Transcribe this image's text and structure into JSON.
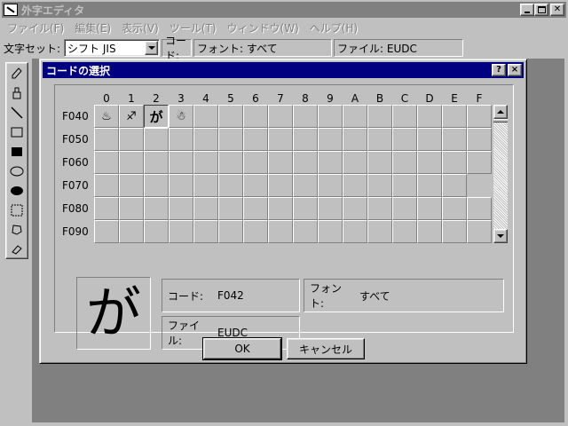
{
  "window": {
    "title": "外字エディタ"
  },
  "menu": [
    "ファイル(F)",
    "編集(E)",
    "表示(V)",
    "ツール(T)",
    "ウィンドウ(W)",
    "ヘルプ(H)"
  ],
  "toolbar": {
    "charset_label": "文字セット:",
    "charset_value": "シフト JIS",
    "code_label": "コード:",
    "font_status": "フォント: すべて",
    "file_status": "ファイル: EUDC"
  },
  "tools": [
    "pencil-icon",
    "brush-icon",
    "line-icon",
    "hollow-rect-icon",
    "filled-rect-icon",
    "hollow-ellipse-icon",
    "filled-ellipse-icon",
    "rect-select-icon",
    "freeform-select-icon",
    "eraser-icon"
  ],
  "dialog": {
    "title": "コードの選択",
    "help_btn": "?",
    "close_btn": "×",
    "columns": [
      "0",
      "1",
      "2",
      "3",
      "4",
      "5",
      "6",
      "7",
      "8",
      "9",
      "A",
      "B",
      "C",
      "D",
      "E",
      "F"
    ],
    "rows": [
      "F040",
      "F050",
      "F060",
      "F070",
      "F080",
      "F090"
    ],
    "glyphs": {
      "F040": [
        "♨",
        "♐",
        "が",
        "☃"
      ]
    },
    "selected_code": "F042",
    "preview_char": "が",
    "code_label": "コード:",
    "code_value": "F042",
    "font_label": "フォント:",
    "font_value": "すべて",
    "file_label": "ファイル:",
    "file_value": "EUDC",
    "ok_label": "OK",
    "cancel_label": "キャンセル"
  },
  "colors": {
    "titlebar_active": "#000080",
    "titlebar_inactive": "#808080",
    "face": "#c0c0c0",
    "workspace": "#808080"
  }
}
